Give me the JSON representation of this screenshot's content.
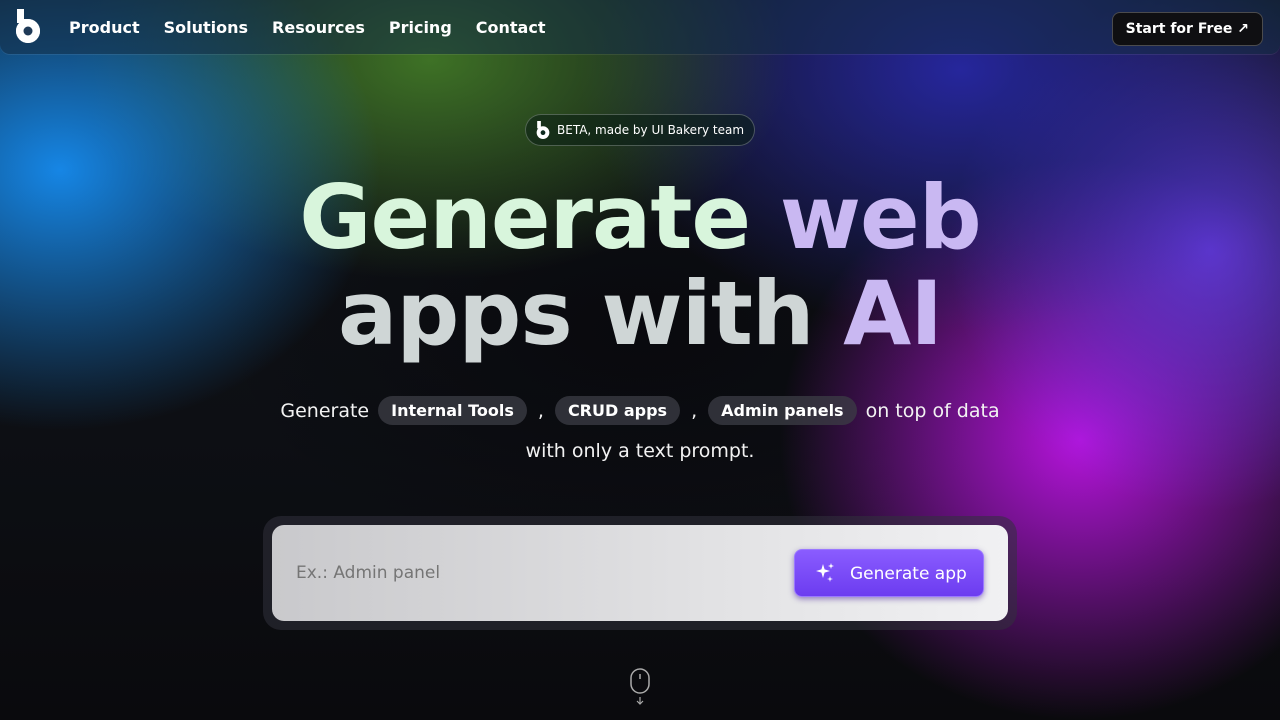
{
  "nav": {
    "links": [
      "Product",
      "Solutions",
      "Resources",
      "Pricing",
      "Contact"
    ],
    "cta_label": "Start for Free ↗"
  },
  "badge": {
    "text": "BETA, made by UI Bakery team"
  },
  "hero": {
    "line1_a": "Generate",
    "line1_b": " web",
    "line2_a": "apps with ",
    "line2_b": "AI"
  },
  "subtitle": {
    "prefix": "Generate",
    "chips": [
      "Internal Tools",
      "CRUD apps",
      "Admin panels"
    ],
    "suffix": "on top of data",
    "line2": "with only a text prompt."
  },
  "prompt": {
    "placeholder": "Ex.: Admin panel",
    "button_label": "Generate app"
  },
  "colors": {
    "accent": "#7c4dff",
    "headline_green": "#d8f5dc",
    "headline_purple": "#c9b8f2"
  }
}
